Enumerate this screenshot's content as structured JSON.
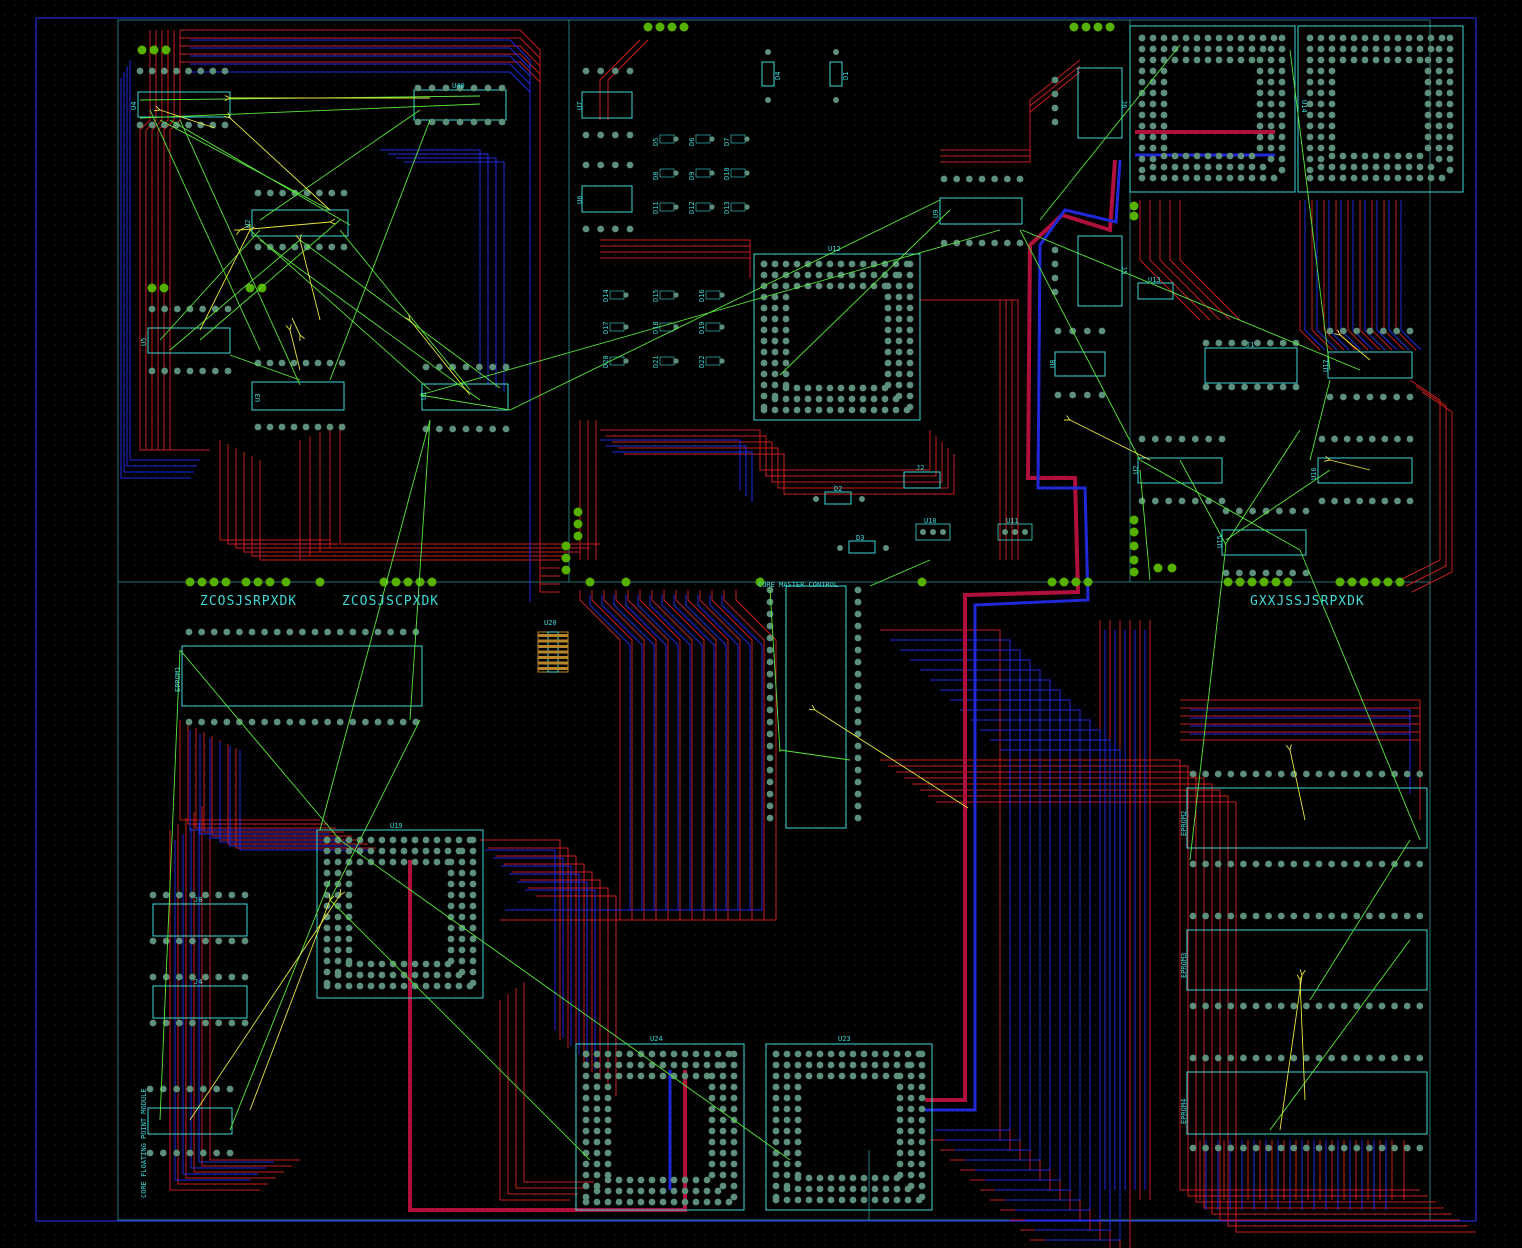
{
  "colors": {
    "background": "#000000",
    "grid": "#3c3c3c",
    "outline": "#2a35ff",
    "silkscreen": "#3fd8d8",
    "trace_top": "#c81e1e",
    "trace_bottom": "#1f2ce0",
    "pad": "#5e8f7a",
    "pad_tab": "#56b000",
    "ratsnest": "#58e83a",
    "force_vector": "#e6e640",
    "power_red": "#b0103c",
    "power_blue": "#2028d8"
  },
  "regions": {
    "region_a": "ZCOSJSRPXDK",
    "region_b": "ZCOSJSCPXDK",
    "region_c": "GXXJSSJSRPXDK",
    "core_master": "CORE MASTER CONTROL",
    "floating_point": "CORE FLOATING POINT MODULE"
  },
  "components": {
    "u1": "U1",
    "u2": "U2",
    "u3": "U3",
    "u4": "U4",
    "u5": "U5",
    "u6": "U6",
    "u7": "U7",
    "u8": "U8",
    "u9": "U9",
    "u10": "U10",
    "u11": "U11",
    "u12": "U12",
    "u13": "U13",
    "u14": "U14",
    "u15": "U15",
    "u16": "U16",
    "u17": "U17",
    "u18": "U18",
    "u19": "U19",
    "u20": "U20",
    "u22": "U22",
    "u23": "U23",
    "u24": "U24",
    "u40": "U40",
    "j1": "J1",
    "j2": "J2",
    "j4": "J4",
    "j5": "J5",
    "j6": "J6",
    "j8": "J8",
    "d1": "D1",
    "d2": "D2",
    "d3": "D3",
    "d4": "D4",
    "eprom1": "EPROM1",
    "eprom2": "EPROM2",
    "eprom3": "EPROM3",
    "eprom4": "EPROM4"
  },
  "diodes": [
    "D5",
    "D6",
    "D7",
    "D8",
    "D9",
    "D10",
    "D11",
    "D12",
    "D13",
    "D14",
    "D15",
    "D16",
    "D17",
    "D18",
    "D19",
    "D20",
    "D21",
    "D22",
    "D23",
    "D24"
  ]
}
